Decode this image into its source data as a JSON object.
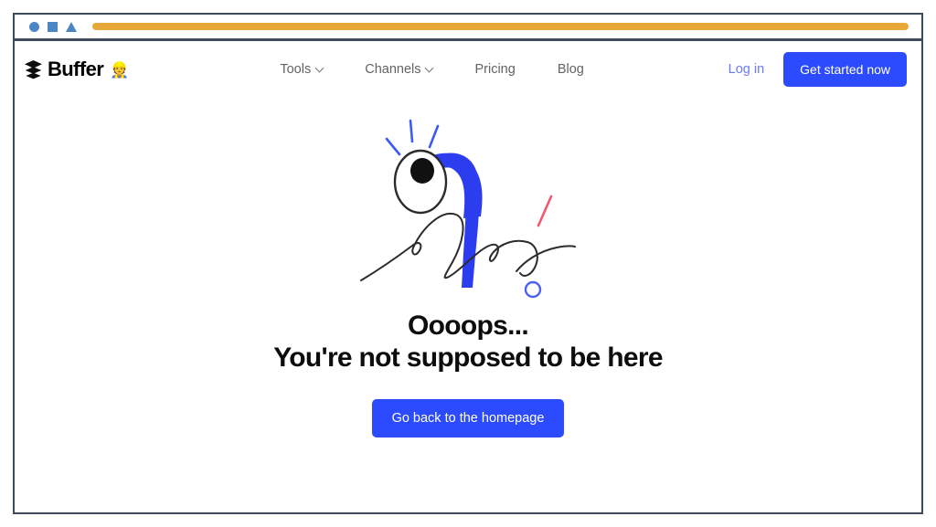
{
  "browser": {
    "toolbar": {
      "shapes": [
        "circle-shape",
        "square-shape",
        "triangle-shape"
      ],
      "shape_color": "#4a85c4",
      "urlbar_color": "#e8a838"
    },
    "frame_border_color": "#3d4b5c"
  },
  "header": {
    "brand": {
      "name": "Buffer",
      "emoji": "👷",
      "icon": "stacked-layers-icon"
    },
    "nav": [
      {
        "label": "Tools",
        "has_dropdown": true
      },
      {
        "label": "Channels",
        "has_dropdown": true
      },
      {
        "label": "Pricing",
        "has_dropdown": false
      },
      {
        "label": "Blog",
        "has_dropdown": false
      }
    ],
    "login_label": "Log in",
    "cta_label": "Get started now",
    "accent_color": "#2c4bff",
    "login_color": "#6b7bf7"
  },
  "hero": {
    "illustration": {
      "name": "confused-worm-illustration",
      "body_color": "#2c3df0",
      "sparkle_color": "#3a5bf5",
      "scribble_color": "#2b2b2b",
      "accent_line_color": "#ef5a6f",
      "circle_color": "#4b62f4",
      "eye_fill": "#ffffff",
      "pupil_color": "#111111"
    },
    "headline_line1": "Oooops...",
    "headline_line2": "You're not supposed to be here",
    "headline_color": "#0d0d0d",
    "cta_label": "Go back to the homepage"
  }
}
